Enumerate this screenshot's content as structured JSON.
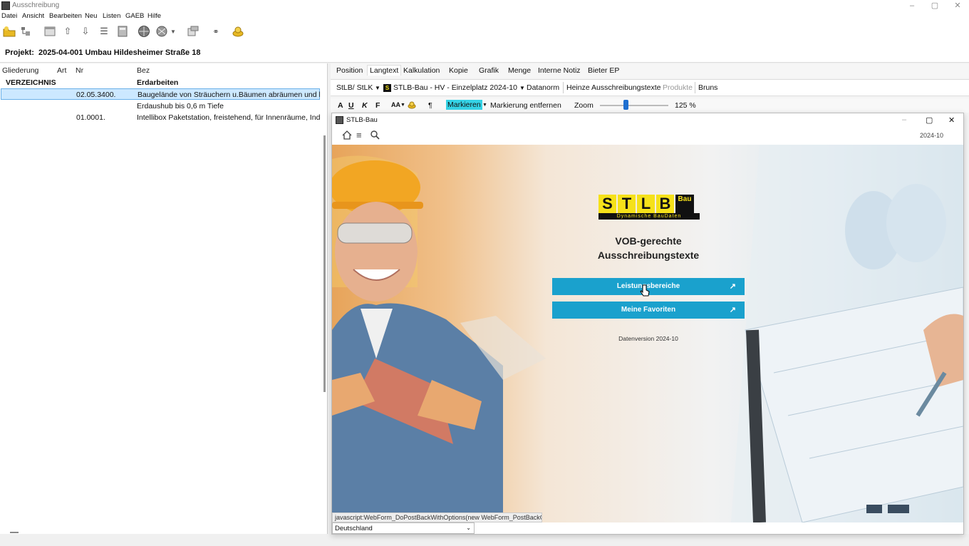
{
  "window": {
    "title": "Ausschreibung",
    "min": "–",
    "max": "▢",
    "close": "✕"
  },
  "menu": [
    "Datei",
    "Ansicht",
    "Bearbeiten",
    "Neu",
    "Listen",
    "GAEB",
    "Hilfe"
  ],
  "toolbar": {
    "icons": [
      "folder-open-icon",
      "tree-icon",
      "window-icon",
      "arrow-up-icon",
      "arrow-down-icon",
      "list-icon",
      "calculator-icon",
      "globe-icon",
      "network-icon",
      "dropdown-icon",
      "export-icon",
      "link-icon",
      "coin-icon"
    ]
  },
  "project": {
    "label": "Projekt:",
    "value": "2025-04-001 Umbau Hildesheimer Straße 18"
  },
  "left": {
    "headers": [
      "Gliederung",
      "Art",
      "Nr",
      "Bez"
    ],
    "rows": [
      {
        "gliederung": "VERZEICHNIS",
        "art": "",
        "nr": "",
        "bez": "Erdarbeiten"
      },
      {
        "gliederung": "",
        "art": "",
        "nr": "02.05.3400.",
        "bez": "Baugelände von Sträuchern u.Bäumen abräumen und b"
      },
      {
        "gliederung": "",
        "art": "",
        "nr": "",
        "bez": "Erdaushub bis 0,6 m Tiefe"
      },
      {
        "gliederung": "",
        "art": "",
        "nr": "01.0001.",
        "bez": "Intellibox Paketstation, freistehend, für Innenräume, Ind"
      }
    ]
  },
  "tabs": [
    "Position",
    "Langtext",
    "Kalkulation",
    "Kopie",
    "Grafik",
    "Menge",
    "Interne Notiz",
    "Bieter EP"
  ],
  "source_bar": {
    "stlk": "StLB/ StLK",
    "stlb": "STLB-Bau - HV - Einzelplatz 2024-10",
    "datanorm": "Datanorm",
    "heinze": "Heinze Ausschreibungstexte",
    "produkte": "Produkte",
    "bruns": "Bruns"
  },
  "format_bar": {
    "bold": "A",
    "underline": "U",
    "italic": "K",
    "fett": "F",
    "fontsize": "AA",
    "pilcrow": "¶",
    "markieren": "Markieren",
    "entfernen": "Markierung entfernen",
    "zoom_label": "Zoom",
    "zoom_value": "125 %",
    "zoom_fraction": 0.38
  },
  "browser": {
    "title": "STLB-Bau",
    "version_top": "2024-10",
    "logo_letters": [
      "S",
      "T",
      "L",
      "B"
    ],
    "logo_suffix": "Bau",
    "logo_tagline": "Dynamische BauDaten",
    "heading_line1": "VOB-gerechte",
    "heading_line2": "Ausschreibungstexte",
    "btn_leistung": "Leistungsbereiche",
    "btn_favoriten": "Meine Favoriten",
    "datenversion": "Datenversion 2024-10",
    "status": "javascript:WebForm_DoPostBackWithOptions(new WebForm_PostBackOpti...",
    "country": "Deutschland"
  },
  "colors": {
    "accent": "#1aa1cd",
    "logo_yellow": "#f5e11a",
    "logo_black": "#111111",
    "selection": "#cce8ff",
    "markieren_bg": "#35d3e6"
  }
}
